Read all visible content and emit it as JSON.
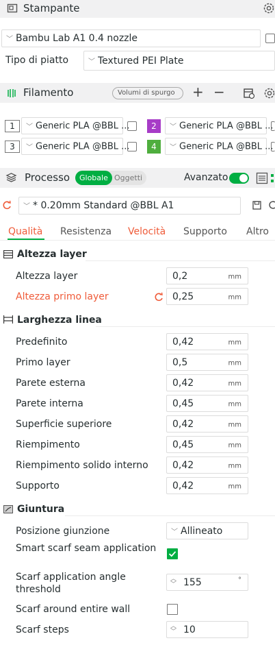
{
  "printer": {
    "title": "Stampante",
    "preset": "Bambu Lab A1 0.4 nozzle",
    "plate_label": "Tipo di piatto",
    "plate_value": "Textured PEI Plate"
  },
  "filament": {
    "title": "Filamento",
    "purge_button": "Volumi di spurgo",
    "slots": [
      {
        "num": "1",
        "name": "Generic PLA @BBL ...",
        "color": "#ffffff",
        "text_color": "#333333"
      },
      {
        "num": "2",
        "name": "Generic PLA @BBL ...",
        "color": "#a73cc7",
        "text_color": "#ffffff"
      },
      {
        "num": "3",
        "name": "Generic PLA @BBL ...",
        "color": "#ffffff",
        "text_color": "#333333"
      },
      {
        "num": "4",
        "name": "Generic PLA @BBL ...",
        "color": "#4fae3e",
        "text_color": "#ffffff"
      }
    ]
  },
  "process": {
    "title": "Processo",
    "toggle_global": "Globale",
    "toggle_objects": "Oggetti",
    "advanced_label": "Avanzato",
    "preset": "* 0.20mm Standard @BBL A1"
  },
  "tabs": [
    {
      "label": "Qualità",
      "active": true
    },
    {
      "label": "Resistenza",
      "active": false
    },
    {
      "label": "Velocità",
      "active": false
    },
    {
      "label": "Supporto",
      "active": false
    },
    {
      "label": "Altro",
      "active": false
    }
  ],
  "sections": {
    "layer_height": {
      "title": "Altezza layer",
      "rows": [
        {
          "label": "Altezza layer",
          "value": "0,2",
          "unit": "mm"
        },
        {
          "label": "Altezza primo layer",
          "value": "0,25",
          "unit": "mm"
        }
      ]
    },
    "line_width": {
      "title": "Larghezza linea",
      "rows": [
        {
          "label": "Predefinito",
          "value": "0,42",
          "unit": "mm"
        },
        {
          "label": "Primo layer",
          "value": "0,5",
          "unit": "mm"
        },
        {
          "label": "Parete esterna",
          "value": "0,42",
          "unit": "mm"
        },
        {
          "label": "Parete interna",
          "value": "0,45",
          "unit": "mm"
        },
        {
          "label": "Superficie superiore",
          "value": "0,42",
          "unit": "mm"
        },
        {
          "label": "Riempimento",
          "value": "0,45",
          "unit": "mm"
        },
        {
          "label": "Riempimento solido interno",
          "value": "0,42",
          "unit": "mm"
        },
        {
          "label": "Supporto",
          "value": "0,42",
          "unit": "mm"
        }
      ]
    },
    "seam": {
      "title": "Giuntura",
      "position_label": "Posizione giunzione",
      "position_value": "Allineato",
      "smart_scarf_label": "Smart scarf seam application",
      "smart_scarf_checked": true,
      "angle_label": "Scarf application angle threshold",
      "angle_value": "155",
      "angle_unit": "°",
      "around_wall_label": "Scarf around entire wall",
      "around_wall_checked": false,
      "steps_label": "Scarf steps",
      "steps_value": "10"
    }
  },
  "colors": {
    "accent": "#00ae42",
    "modified": "#ef5b39",
    "header_bg": "#f1f1f2"
  },
  "icons": {
    "printer": "printer-icon",
    "settings": "gear-icon",
    "edit": "edit-icon",
    "filament": "filament-icon",
    "add": "plus-icon",
    "remove": "minus-icon",
    "process": "layers-icon",
    "reset": "undo-arrow-icon",
    "save": "save-icon"
  }
}
